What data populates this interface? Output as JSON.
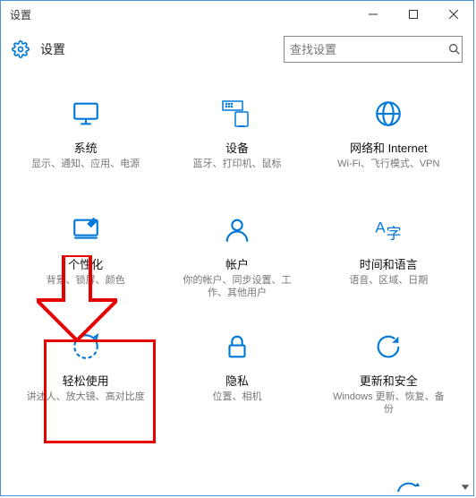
{
  "window": {
    "title": "设置"
  },
  "header": {
    "app_title": "设置",
    "search_placeholder": "查找设置"
  },
  "tiles": [
    {
      "title": "系统",
      "desc": "显示、通知、应用、电源"
    },
    {
      "title": "设备",
      "desc": "蓝牙、打印机、鼠标"
    },
    {
      "title": "网络和 Internet",
      "desc": "Wi-Fi、飞行模式、VPN"
    },
    {
      "title": "个性化",
      "desc": "背景、锁屏、颜色"
    },
    {
      "title": "帐户",
      "desc": "你的帐户、同步设置、工作、其他用户"
    },
    {
      "title": "时间和语言",
      "desc": "语音、区域、日期"
    },
    {
      "title": "轻松使用",
      "desc": "讲述人、放大镜、高对比度"
    },
    {
      "title": "隐私",
      "desc": "位置、相机"
    },
    {
      "title": "更新和安全",
      "desc": "Windows 更新、恢复、备份"
    }
  ]
}
